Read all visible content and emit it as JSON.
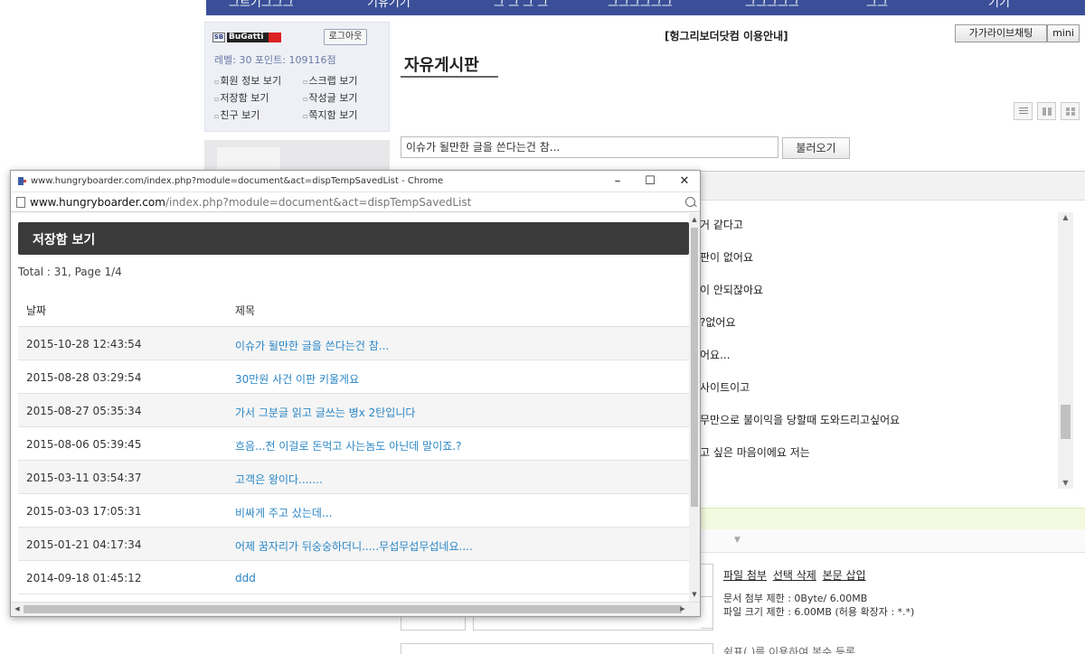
{
  "site": {
    "nav_items": [
      "그르기그그그",
      "기유기기",
      "그 그 그 그",
      "그그그그그그",
      "그그그그그",
      "그그",
      "기기"
    ],
    "user": {
      "logo_text": "BuGatti",
      "logo_badge": "SB",
      "logout_label": "로그아웃",
      "stats": "레벨: 30   포인트: 109116점",
      "links": [
        "회원 정보 보기",
        "스크랩 보기",
        "저장함 보기",
        "작성글 보기",
        "친구 보기",
        "쪽지함 보기"
      ]
    },
    "notice_link": "[헝그리보더닷컴 이용안내]",
    "chat_label": "가가라이브채팅",
    "mini_label": "mini",
    "board_title": "자유게시판",
    "title_input_value": "이슈가 될만한 글을 쓴다는건 참...",
    "load_label": "불러오기",
    "editor_lines": [
      "거 같다고",
      "판이 없어요",
      "이 안되잖아요",
      "?없어요",
      "어요...",
      "사이트이고",
      "무만으로 불이익을 당할때 도와드리고싶어요",
      "고 싶은 마음이에요 저는"
    ],
    "file_actions": [
      "파일 첨부",
      "선택 삭제",
      "본문 삽입"
    ],
    "file_limit_doc": "문서 첨부 제한 : 0Byte/ 6.00MB",
    "file_limit_size": "파일 크기 제한 : 6.00MB (허용 확장자 : *.*)",
    "tag_help": "쉼표(,)를 이용하여 복수 등록"
  },
  "popup": {
    "window_title": "www.hungryboarder.com/index.php?module=document&act=dispTempSavedList - Chrome",
    "url_host": "www.hungryboarder.com",
    "url_path": "/index.php?module=document&act=dispTempSavedList",
    "controls": {
      "minimize": "–",
      "maximize": "☐",
      "close": "✕"
    },
    "header": "저장함 보기",
    "total": "Total : 31, Page 1/4",
    "columns": {
      "date": "날짜",
      "title": "제목"
    },
    "rows": [
      {
        "date": "2015-10-28 12:43:54",
        "title": "이슈가 될만한 글을 쓴다는건 참..."
      },
      {
        "date": "2015-08-28 03:29:54",
        "title": "30만원 사건 이판 키울게요"
      },
      {
        "date": "2015-08-27 05:35:34",
        "title": "가서 그분글 읽고 글쓰는 병x 2탄입니다"
      },
      {
        "date": "2015-08-06 05:39:45",
        "title": "흐음...전 이걸로 돈먹고 사는놈도 아닌데 말이죠.?"
      },
      {
        "date": "2015-03-11 03:54:37",
        "title": "고객은 왕이다......."
      },
      {
        "date": "2015-03-03 17:05:31",
        "title": "비싸게 주고 샀는데..."
      },
      {
        "date": "2015-01-21 04:17:34",
        "title": "어제 꿈자리가 뒤숭숭하더니.....무섭무섭무섭네요...."
      },
      {
        "date": "2014-09-18 01:45:12",
        "title": "ddd"
      }
    ]
  }
}
